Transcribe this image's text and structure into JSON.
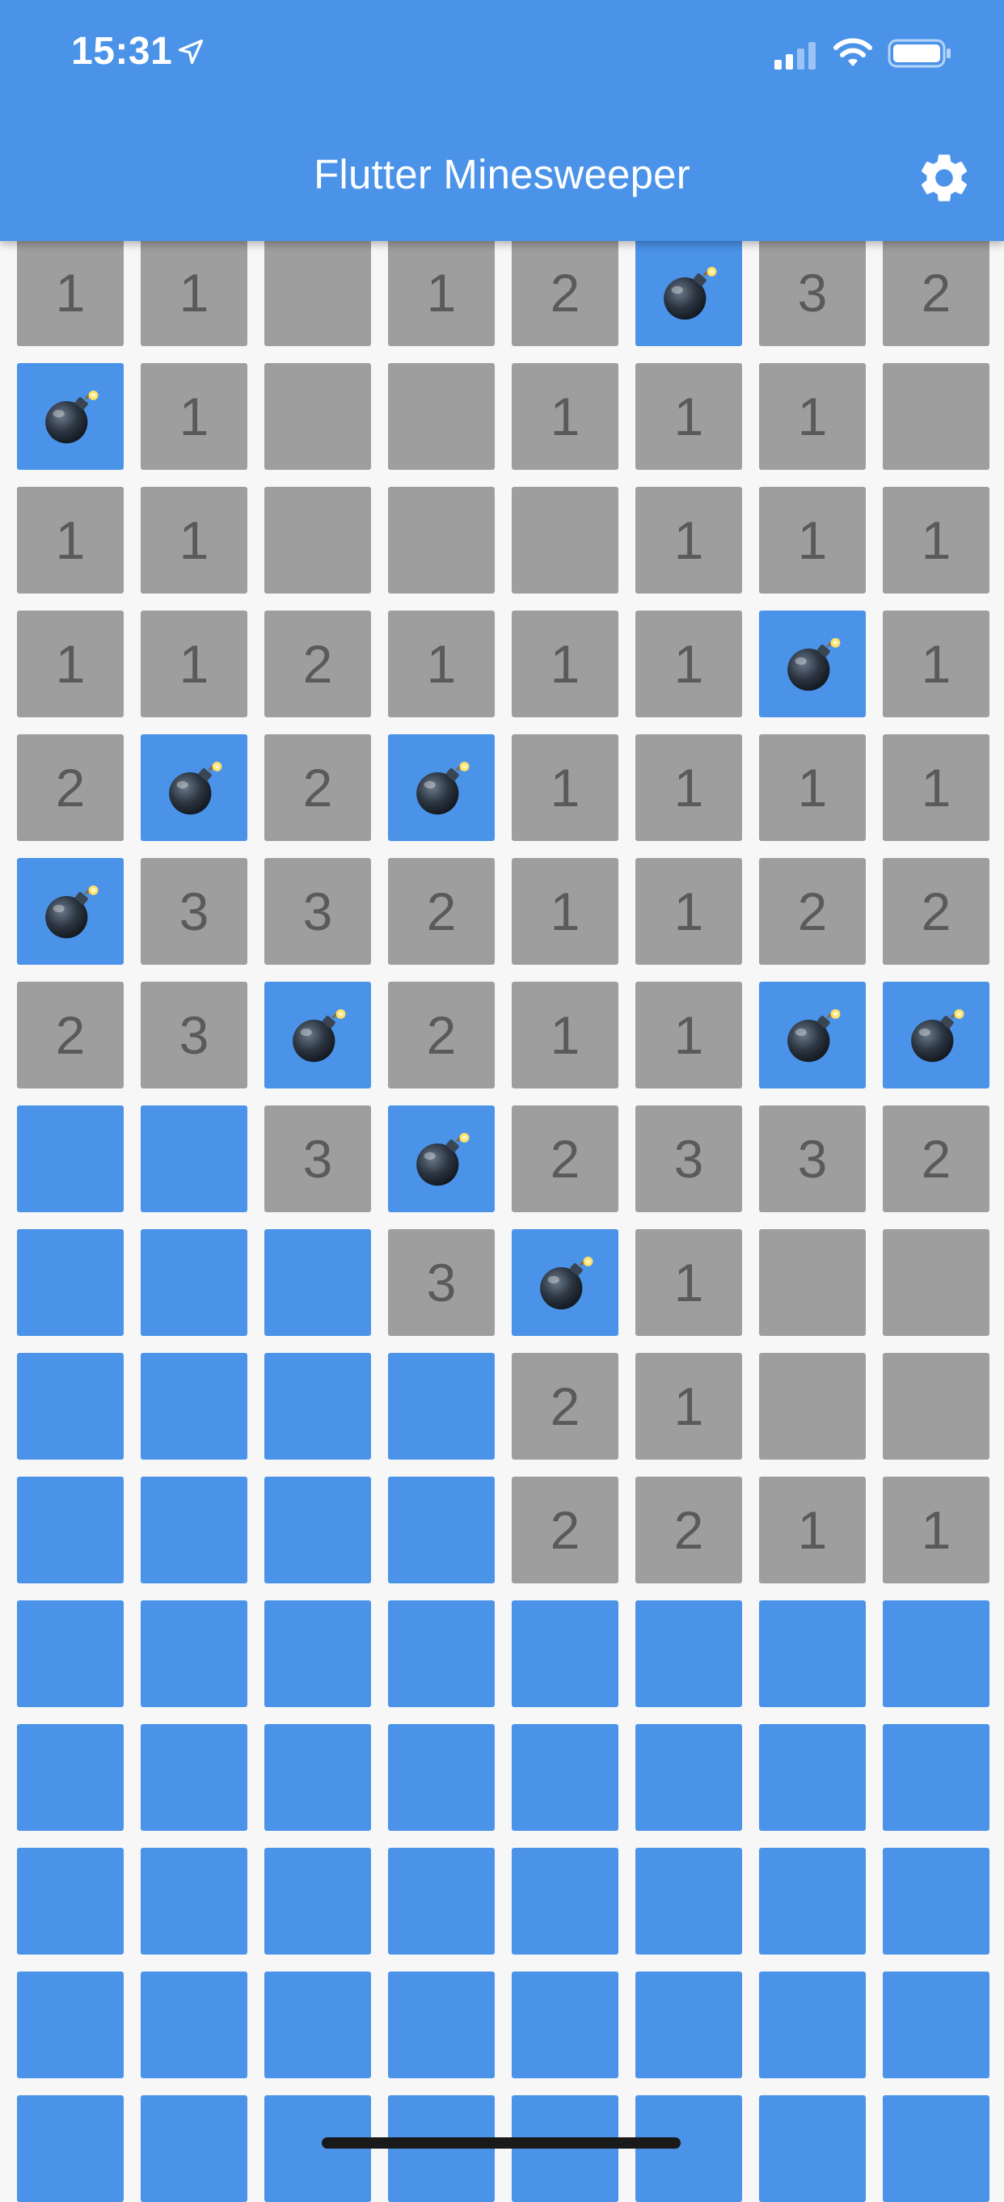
{
  "status_bar": {
    "time": "15:31",
    "icons": [
      "location-arrow-icon",
      "cellular-signal-icon",
      "wifi-icon",
      "battery-icon"
    ]
  },
  "app_bar": {
    "title": "Flutter Minesweeper",
    "settings_icon": "gear-icon"
  },
  "colors": {
    "accent": "#4a93e9",
    "revealed_cell": "#9e9e9e",
    "number_text": "#5a5a5a",
    "background": "#f7f7f7"
  },
  "board": {
    "columns": 8,
    "visible_rows": 16,
    "legend": {
      "H": "hidden",
      "B": "bomb",
      "E": "revealed-empty",
      "1-8": "revealed-number"
    },
    "rows": [
      [
        "1",
        "1",
        "E",
        "1",
        "2",
        "B",
        "3",
        "2"
      ],
      [
        "B",
        "1",
        "E",
        "E",
        "1",
        "1",
        "1",
        "E"
      ],
      [
        "1",
        "1",
        "E",
        "E",
        "E",
        "1",
        "1",
        "1"
      ],
      [
        "1",
        "1",
        "2",
        "1",
        "1",
        "1",
        "B",
        "1"
      ],
      [
        "2",
        "B",
        "2",
        "B",
        "1",
        "1",
        "1",
        "1"
      ],
      [
        "B",
        "3",
        "3",
        "2",
        "1",
        "1",
        "2",
        "2"
      ],
      [
        "2",
        "3",
        "B",
        "2",
        "1",
        "1",
        "B",
        "B"
      ],
      [
        "H",
        "H",
        "3",
        "B",
        "2",
        "3",
        "3",
        "2"
      ],
      [
        "H",
        "H",
        "H",
        "3",
        "B",
        "1",
        "E",
        "E"
      ],
      [
        "H",
        "H",
        "H",
        "H",
        "2",
        "1",
        "E",
        "E"
      ],
      [
        "H",
        "H",
        "H",
        "H",
        "2",
        "2",
        "1",
        "1"
      ],
      [
        "H",
        "H",
        "H",
        "H",
        "H",
        "H",
        "H",
        "H"
      ],
      [
        "H",
        "H",
        "H",
        "H",
        "H",
        "H",
        "H",
        "H"
      ],
      [
        "H",
        "H",
        "H",
        "H",
        "H",
        "H",
        "H",
        "H"
      ],
      [
        "H",
        "H",
        "H",
        "H",
        "H",
        "H",
        "H",
        "H"
      ],
      [
        "H",
        "H",
        "H",
        "H",
        "H",
        "H",
        "H",
        "H"
      ]
    ]
  }
}
